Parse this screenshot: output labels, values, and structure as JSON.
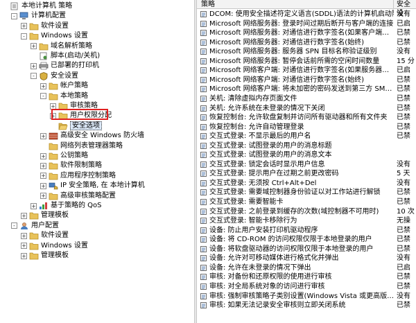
{
  "tree": [
    {
      "label": "本地计算机 策略",
      "depth": 0,
      "exp": "none",
      "icon": "computer-policy-icon"
    },
    {
      "label": "计算机配置",
      "depth": 1,
      "exp": "-",
      "icon": "computer-icon"
    },
    {
      "label": "软件设置",
      "depth": 2,
      "exp": "+",
      "icon": "folder-icon"
    },
    {
      "label": "Windows 设置",
      "depth": 2,
      "exp": "-",
      "icon": "folder-icon"
    },
    {
      "label": "域名解析策略",
      "depth": 3,
      "exp": "+",
      "icon": "folder-icon"
    },
    {
      "label": "脚本(启动/关机)",
      "depth": 3,
      "exp": "none",
      "icon": "script-icon"
    },
    {
      "label": "已部署的打印机",
      "depth": 3,
      "exp": "+",
      "icon": "printer-icon"
    },
    {
      "label": "安全设置",
      "depth": 3,
      "exp": "-",
      "icon": "shield-icon"
    },
    {
      "label": "帐户策略",
      "depth": 4,
      "exp": "+",
      "icon": "folder-icon"
    },
    {
      "label": "本地策略",
      "depth": 4,
      "exp": "-",
      "icon": "folder-icon"
    },
    {
      "label": "审核策略",
      "depth": 5,
      "exp": "+",
      "icon": "folder-icon"
    },
    {
      "label": "用户权限分配",
      "depth": 5,
      "exp": "+",
      "icon": "folder-icon"
    },
    {
      "label": "安全选项",
      "depth": 5,
      "exp": "none",
      "icon": "folder-open-icon",
      "selected": true
    },
    {
      "label": "高级安全 Windows 防火墙",
      "depth": 4,
      "exp": "+",
      "icon": "firewall-icon"
    },
    {
      "label": "网络列表管理器策略",
      "depth": 4,
      "exp": "none",
      "icon": "folder-icon"
    },
    {
      "label": "公钥策略",
      "depth": 4,
      "exp": "+",
      "icon": "folder-icon"
    },
    {
      "label": "软件限制策略",
      "depth": 4,
      "exp": "+",
      "icon": "folder-icon"
    },
    {
      "label": "应用程序控制策略",
      "depth": 4,
      "exp": "+",
      "icon": "folder-icon"
    },
    {
      "label": "IP 安全策略, 在 本地计算机",
      "depth": 4,
      "exp": "+",
      "icon": "ip-security-icon"
    },
    {
      "label": "高级审核策略配置",
      "depth": 4,
      "exp": "+",
      "icon": "folder-icon"
    },
    {
      "label": "基于策略的 QoS",
      "depth": 3,
      "exp": "+",
      "icon": "chart-icon"
    },
    {
      "label": "管理模板",
      "depth": 2,
      "exp": "+",
      "icon": "folder-icon"
    },
    {
      "label": "用户配置",
      "depth": 1,
      "exp": "-",
      "icon": "user-icon"
    },
    {
      "label": "软件设置",
      "depth": 2,
      "exp": "+",
      "icon": "folder-icon"
    },
    {
      "label": "Windows 设置",
      "depth": 2,
      "exp": "+",
      "icon": "folder-icon"
    },
    {
      "label": "管理模板",
      "depth": 2,
      "exp": "+",
      "icon": "folder-icon"
    }
  ],
  "headers": {
    "policy": "策略",
    "setting": "安全设"
  },
  "policies": [
    {
      "name": "DCOM: 使用安全描述符定义语言(SDDL)语法的计算机启动限制",
      "value": "没有"
    },
    {
      "name": "Microsoft 网络服务器: 登录时间过期后断开与客户端的连接",
      "value": "已启"
    },
    {
      "name": "Microsoft 网络服务器: 对通信进行数字签名(如果客户端…",
      "value": "已禁"
    },
    {
      "name": "Microsoft 网络服务器: 对通信进行数字签名(始终)",
      "value": "已禁"
    },
    {
      "name": "Microsoft 网络服务器: 服务器 SPN 目标名称验证级别",
      "value": "没有"
    },
    {
      "name": "Microsoft 网络服务器: 暂停会话前所需的空闲时间数量",
      "value": "15 分"
    },
    {
      "name": "Microsoft 网络客户端: 对通信进行数字签名(如果服务器…",
      "value": "已启"
    },
    {
      "name": "Microsoft 网络客户端: 对通信进行数字签名(始终)",
      "value": "已禁"
    },
    {
      "name": "Microsoft 网络客户端: 将未加密的密码发送到第三方 SM…",
      "value": "已禁"
    },
    {
      "name": "关机: 清除虚拟内存页面文件",
      "value": "已禁"
    },
    {
      "name": "关机: 允许系统在未登录的情况下关闭",
      "value": "已禁"
    },
    {
      "name": "恢复控制台: 允许软盘复制并访问所有驱动器和所有文件夹",
      "value": "已禁"
    },
    {
      "name": "恢复控制台: 允许自动管理登录",
      "value": "已禁"
    },
    {
      "name": "交互式登录: 不显示最后的用户名",
      "value": "已禁"
    },
    {
      "name": "交互式登录: 试图登录的用户的消息标题",
      "value": ""
    },
    {
      "name": "交互式登录: 试图登录的用户的消息文本",
      "value": ""
    },
    {
      "name": "交互式登录: 锁定会话时显示用户信息",
      "value": "没有"
    },
    {
      "name": "交互式登录: 提示用户在过期之前更改密码",
      "value": "5 天"
    },
    {
      "name": "交互式登录: 无须按 Ctrl+Alt+Del",
      "value": "没有"
    },
    {
      "name": "交互式登录: 需要域控制器身份验证以对工作站进行解锁",
      "value": "已禁"
    },
    {
      "name": "交互式登录: 需要智能卡",
      "value": "已禁"
    },
    {
      "name": "交互式登录: 之前登录到缓存的次数(域控制器不可用时)",
      "value": "10 次"
    },
    {
      "name": "交互式登录: 智能卡移除行为",
      "value": "无操"
    },
    {
      "name": "设备: 防止用户安装打印机驱动程序",
      "value": "已禁"
    },
    {
      "name": "设备: 将 CD-ROM 的访问权限仅限于本地登录的用户",
      "value": "已禁"
    },
    {
      "name": "设备: 将软盘驱动器的访问权限仅限于本地登录的用户",
      "value": "已禁"
    },
    {
      "name": "设备: 允许对可移动媒体进行格式化并弹出",
      "value": "没有"
    },
    {
      "name": "设备: 允许在未登录的情况下弹出",
      "value": "已启"
    },
    {
      "name": "审核: 对备份和还原权限的使用进行审核",
      "value": "已禁"
    },
    {
      "name": "审核: 对全局系统对象的访问进行审核",
      "value": "已禁"
    },
    {
      "name": "审核: 强制审核策略子类别设置(Windows Vista 或更高版…",
      "value": "没有"
    },
    {
      "name": "审核: 如果无法记录安全审核则立即关闭系统",
      "value": "已禁"
    }
  ]
}
